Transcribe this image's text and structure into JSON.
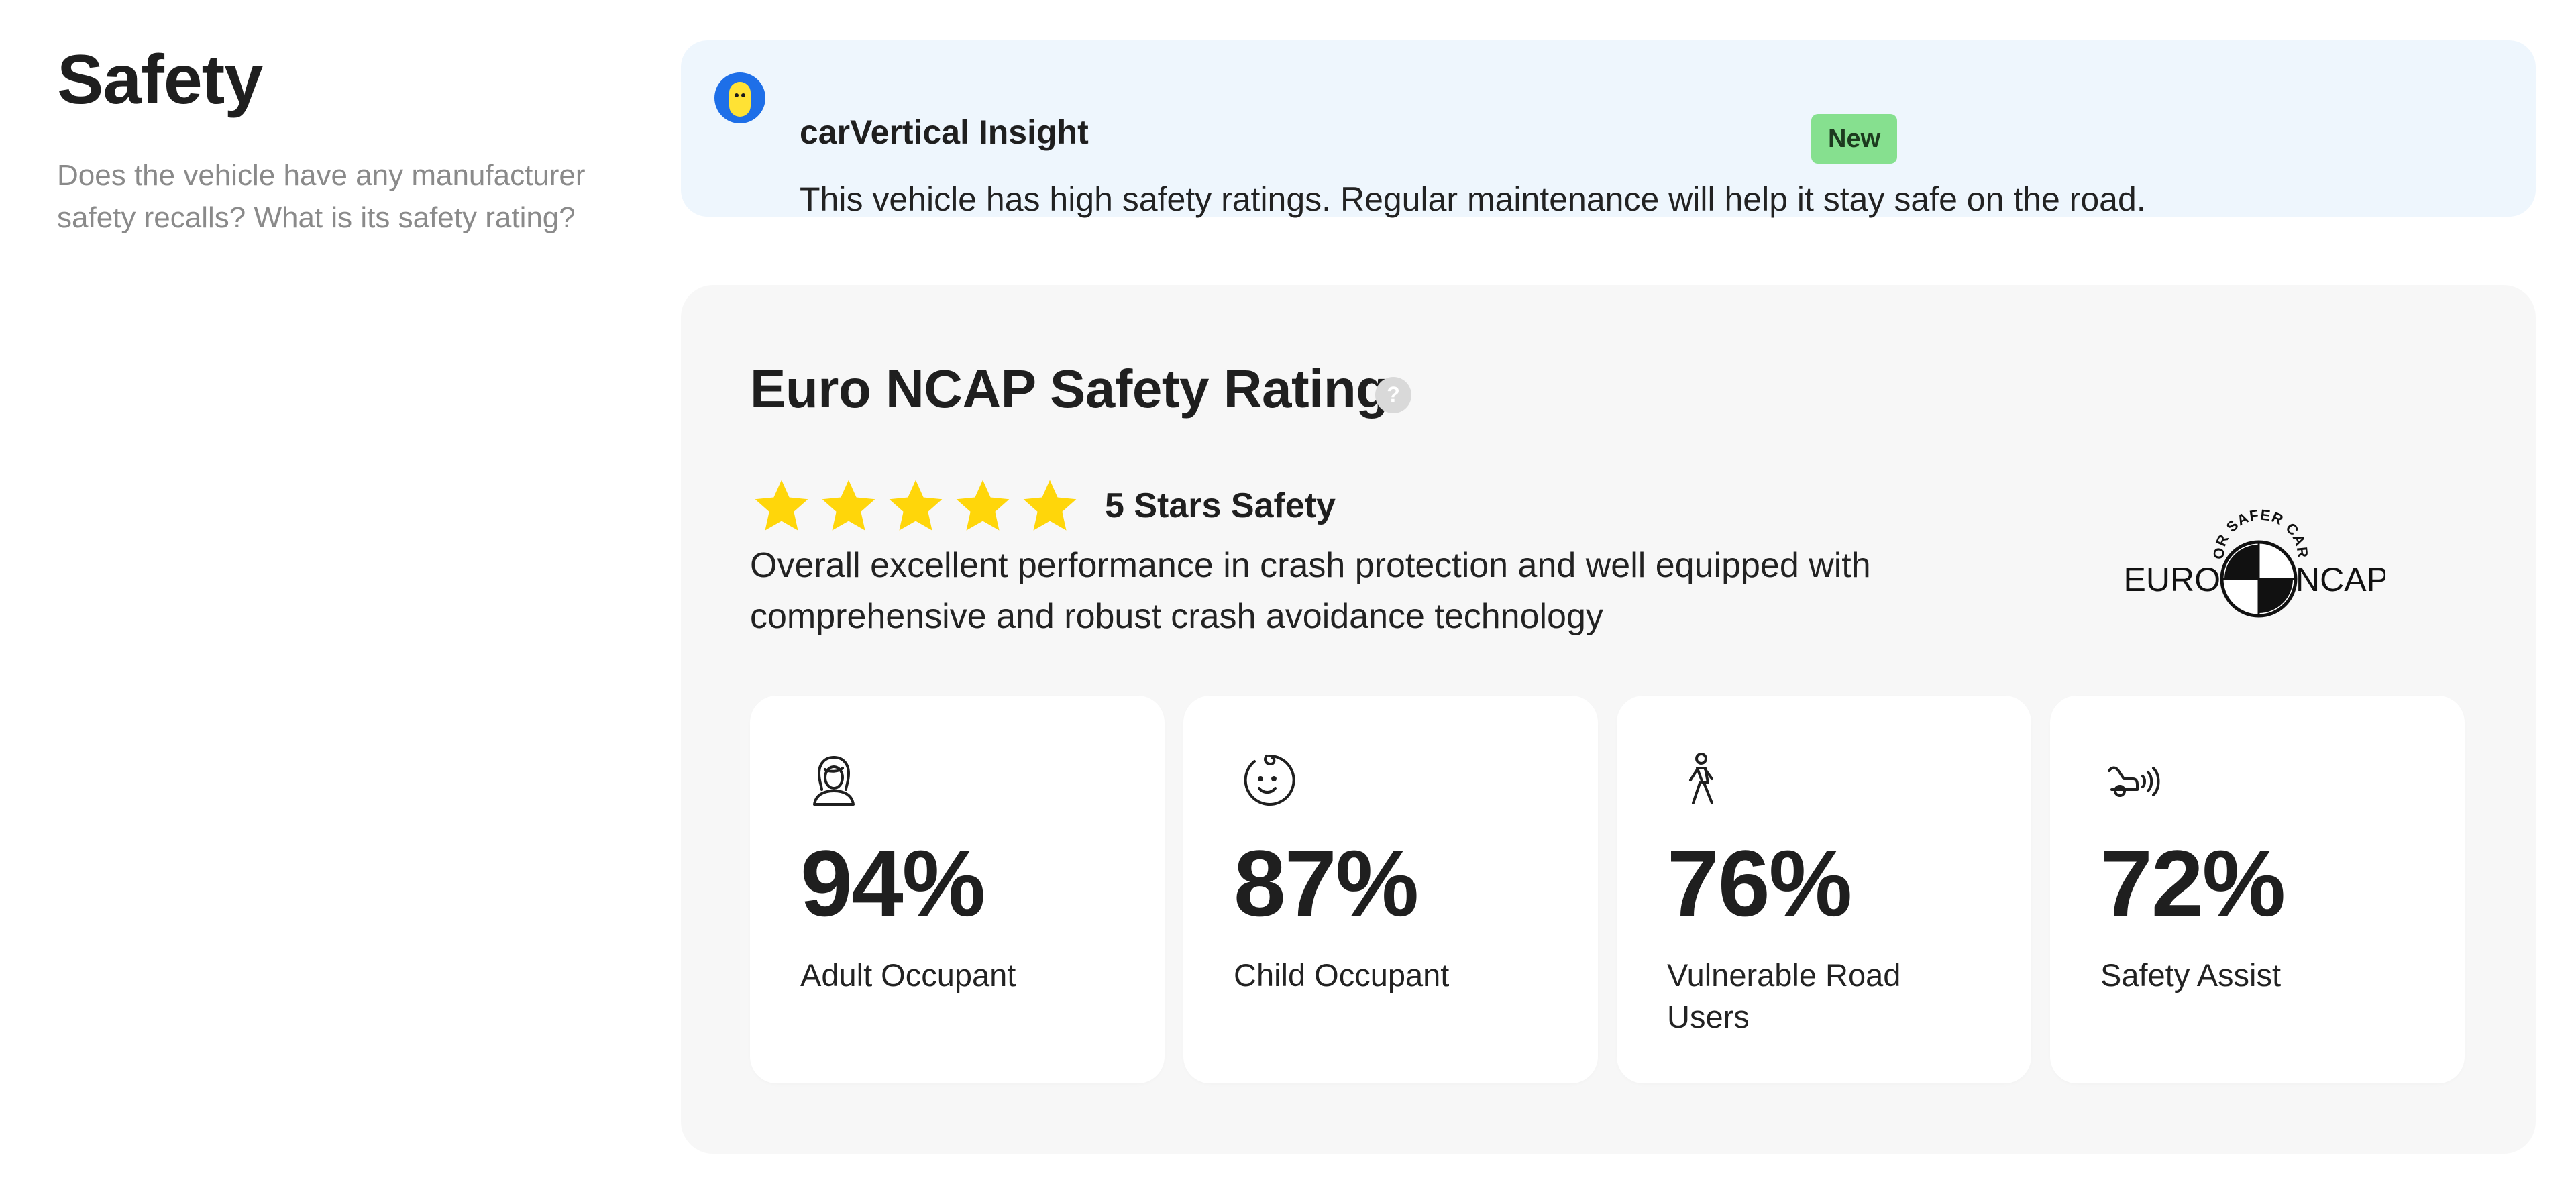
{
  "section": {
    "title": "Safety",
    "description": "Does the vehicle have any manufacturer safety recalls? What is its safety rating?"
  },
  "insight": {
    "title": "carVertical Insight",
    "badge": "New",
    "text": "This vehicle has high safety ratings. Regular maintenance will help it stay safe on the road."
  },
  "rating": {
    "title": "Euro NCAP Safety Rating",
    "help_icon": "question-circle-icon",
    "stars": 5,
    "stars_max": 5,
    "stars_label": "5 Stars Safety",
    "description": "Overall excellent performance in crash protection and well equipped with comprehensive and robust crash avoidance technology",
    "logo": {
      "left_text": "EURO",
      "right_text": "NCAP",
      "arc_text": "FOR SAFER CARS"
    },
    "cards": [
      {
        "icon": "adult-icon",
        "percent": "94%",
        "label": "Adult Occupant"
      },
      {
        "icon": "child-icon",
        "percent": "87%",
        "label": "Child Occupant"
      },
      {
        "icon": "pedestrian-icon",
        "percent": "76%",
        "label": "Vulnerable Road Users"
      },
      {
        "icon": "car-sensor-icon",
        "percent": "72%",
        "label": "Safety Assist"
      }
    ]
  },
  "colors": {
    "insight_bg": "#eef6fd",
    "badge_bg": "#86e08f",
    "card_bg": "#f7f7f7",
    "star": "#ffd60a"
  }
}
